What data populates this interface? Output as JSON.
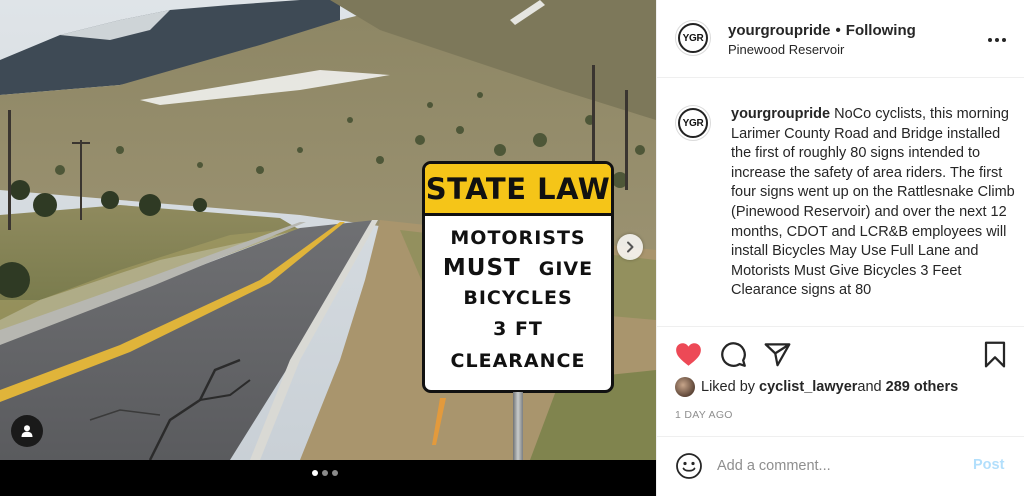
{
  "sign": {
    "header": "STATE LAW",
    "line1": "MOTORISTS",
    "line2a": "MUST",
    "line2b": "GIVE",
    "line3": "BICYCLES",
    "line4": "3  FT",
    "line5": "CLEARANCE"
  },
  "carousel": {
    "count": 3,
    "active": 0
  },
  "post": {
    "avatar_text": "YGR",
    "username": "yourgroupride",
    "separator": "•",
    "follow_status": "Following",
    "location": "Pinewood Reservoir",
    "caption_user": "yourgroupride",
    "caption_text": " NoCo cyclists, this morning Larimer County Road and Bridge installed the first of roughly 80 signs intended to increase the safety of area riders. The first four signs went up on the Rattlesnake Climb (Pinewood Reservoir) and over the next 12 months, CDOT and LCR&B employees will install Bicycles May Use Full Lane and Motorists Must Give Bicycles 3 Feet Clearance signs at 80",
    "liked_by_prefix": "Liked by ",
    "liked_by_user": "cyclist_lawyer",
    "liked_by_and": " and ",
    "liked_by_others": "289 others",
    "time_ago": "1 DAY AGO"
  },
  "comment": {
    "placeholder": "Add a comment...",
    "post_label": "Post"
  },
  "colors": {
    "like_red": "#ed4956",
    "sign_yellow": "#f5c518",
    "post_disabled": "#b2dffc"
  }
}
